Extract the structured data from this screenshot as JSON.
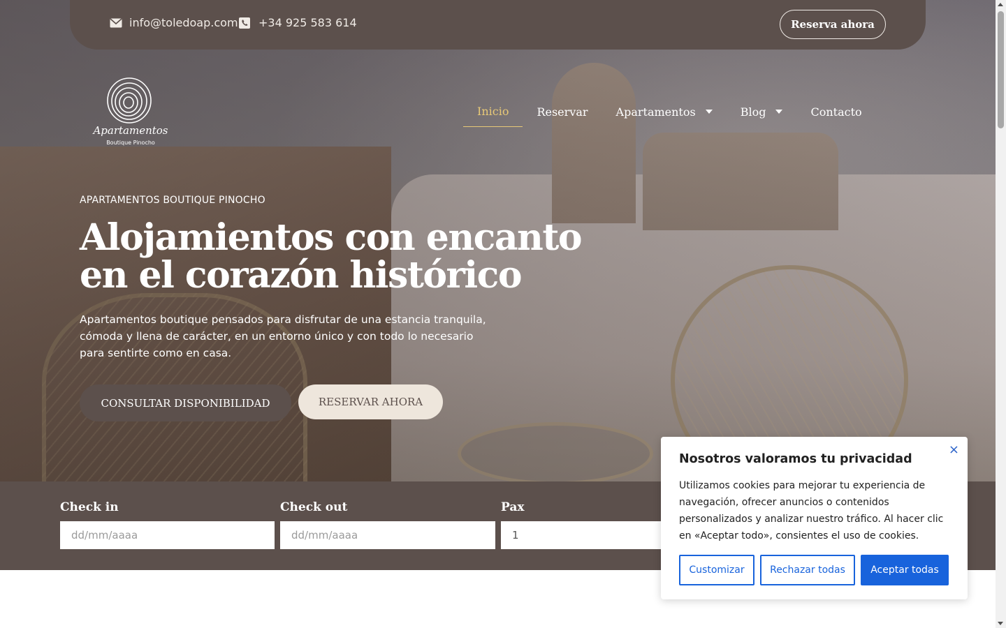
{
  "topbar": {
    "email": "info@toledoap.com",
    "phone": "+34 925 583 614",
    "reserve_label": "Reserva ahora"
  },
  "logo": {
    "word": "Apartamentos",
    "sub": "Boutique Pinocho"
  },
  "nav": {
    "items": [
      {
        "label": "Inicio",
        "active": true
      },
      {
        "label": "Reservar"
      },
      {
        "label": "Apartamentos",
        "dropdown": true
      },
      {
        "label": "Blog",
        "dropdown": true
      },
      {
        "label": "Contacto"
      }
    ]
  },
  "hero": {
    "eyebrow": "APARTAMENTOS BOUTIQUE PINOCHO",
    "headline_line1": "Alojamientos con encanto",
    "headline_line2": "en el corazón histórico",
    "lead": "Apartamentos boutique pensados para disfrutar de una estancia tranquila, cómoda y llena de carácter, en un entorno único y con todo lo necesario para sentirte como en casa.",
    "btn_availability": "CONSULTAR DISPONIBILIDAD",
    "btn_reserve": "RESERVAR AHORA"
  },
  "booking": {
    "checkin_label": "Check in",
    "checkin_placeholder": "dd/mm/aaaa",
    "checkout_label": "Check out",
    "checkout_placeholder": "dd/mm/aaaa",
    "pax_label": "Pax",
    "pax_value": "1"
  },
  "cookie": {
    "title": "Nosotros valoramos tu privacidad",
    "text": "Utilizamos cookies para mejorar tu experiencia de navegación, ofrecer anuncios o contenidos personalizados y analizar nuestro tráfico. Al hacer clic en «Aceptar todo», consientes el uso de cookies.",
    "customize": "Customizar",
    "reject": "Rechazar todas",
    "accept": "Aceptar todas",
    "close_icon": "×"
  },
  "colors": {
    "brown": "#5c504c",
    "cream": "#eee6dc",
    "active_nav": "#e8c977",
    "cookie_blue": "#1863dc"
  }
}
